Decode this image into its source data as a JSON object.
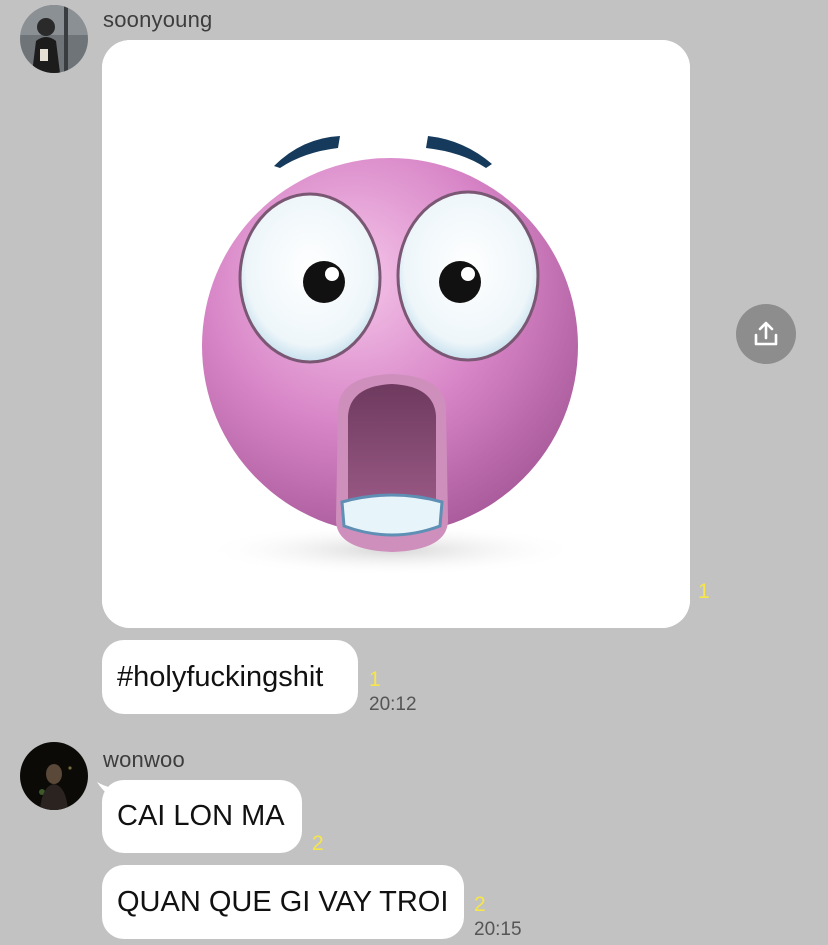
{
  "messages": [
    {
      "sender": "soonyoung",
      "image": {
        "unread": "1"
      },
      "text": "#holyfuckingshit",
      "unread": "1",
      "time": "20:12"
    },
    {
      "sender": "wonwoo",
      "bubbles": [
        {
          "text": "CAI LON MA",
          "unread": "2"
        },
        {
          "text": "QUAN QUE GI VAY TROI",
          "unread": "2"
        }
      ],
      "time": "20:15"
    }
  ],
  "icons": {
    "share": "share-upload-icon",
    "emoji": "shocked-face-emoji"
  },
  "colors": {
    "background": "#c2c2c2",
    "bubble": "#ffffff",
    "unread": "#f6e64a",
    "share_button": "#8d8d8d"
  }
}
